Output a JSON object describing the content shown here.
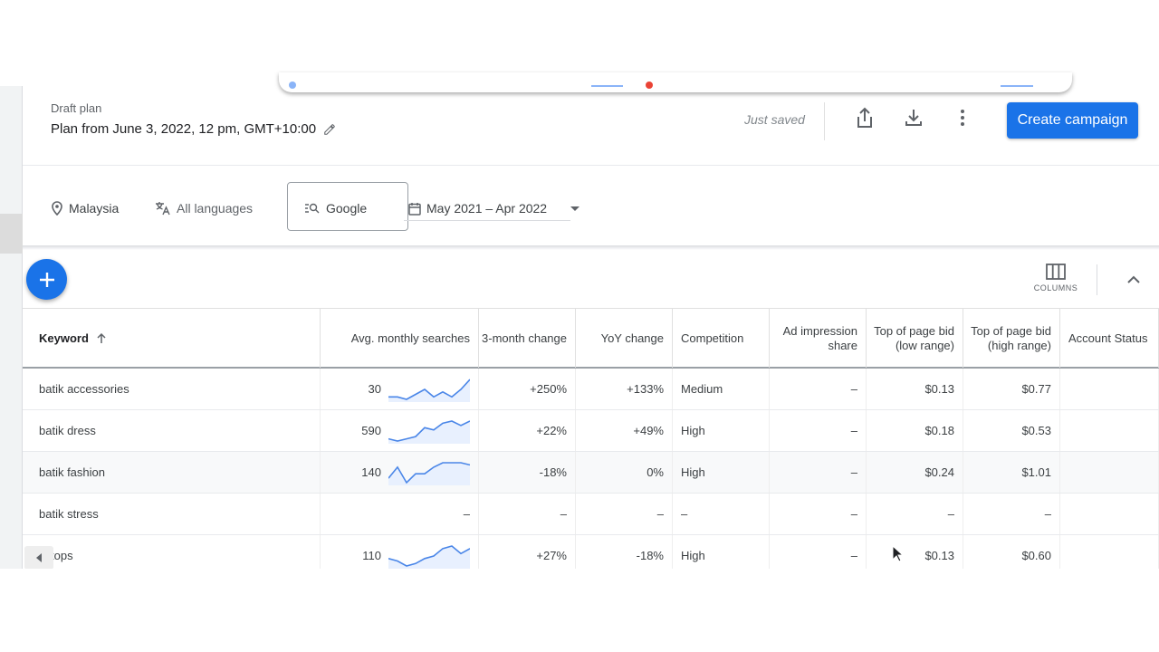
{
  "header": {
    "draft_label": "Draft plan",
    "plan_title": "Plan from June 3, 2022, 12 pm, GMT+10:00",
    "status": "Just saved",
    "create_button": "Create campaign",
    "icons": [
      "share-icon",
      "download-icon",
      "more-vert-icon",
      "pencil-icon"
    ]
  },
  "filters": {
    "location": "Malaysia",
    "language": "All languages",
    "network": "Google",
    "date_range": "May 2021 – Apr 2022"
  },
  "toolbar": {
    "columns_label": "COLUMNS"
  },
  "colors": {
    "accent": "#1a73e8",
    "sparkline": "#4a86e8",
    "sparkline_fill": "#e8f0fe"
  },
  "table": {
    "columns": [
      "Keyword",
      "Avg. monthly searches",
      "3-month change",
      "YoY change",
      "Competition",
      "Ad impression share",
      "Top of page bid (low range)",
      "Top of page bid (high range)",
      "Account Status"
    ],
    "rows": [
      {
        "keyword": "batik accessories",
        "searches": "30",
        "trend": [
          2,
          2,
          1,
          3,
          5,
          2,
          4,
          2,
          5,
          9
        ],
        "three_month": "+250%",
        "yoy": "+133%",
        "competition": "Medium",
        "impression_share": "–",
        "bid_low": "$0.13",
        "bid_high": "$0.77",
        "account_status": ""
      },
      {
        "keyword": "batik dress",
        "searches": "590",
        "trend": [
          2,
          1,
          2,
          3,
          7,
          6,
          9,
          10,
          8,
          10
        ],
        "three_month": "+22%",
        "yoy": "+49%",
        "competition": "High",
        "impression_share": "–",
        "bid_low": "$0.18",
        "bid_high": "$0.53",
        "account_status": ""
      },
      {
        "keyword": "batik fashion",
        "searches": "140",
        "trend": [
          3,
          8,
          1,
          5,
          5,
          8,
          10,
          10,
          10,
          9
        ],
        "three_month": "-18%",
        "yoy": "0%",
        "competition": "High",
        "impression_share": "–",
        "bid_low": "$0.24",
        "bid_high": "$1.01",
        "account_status": ""
      },
      {
        "keyword": "batik stress",
        "searches": "–",
        "trend": null,
        "three_month": "–",
        "yoy": "–",
        "competition": "–",
        "impression_share": "–",
        "bid_low": "–",
        "bid_high": "–",
        "account_status": ""
      },
      {
        "keyword": "ik tops",
        "searches": "110",
        "trend": [
          4,
          3,
          1,
          2,
          4,
          5,
          8,
          9,
          6,
          8
        ],
        "three_month": "+27%",
        "yoy": "-18%",
        "competition": "High",
        "impression_share": "–",
        "bid_low": "$0.13",
        "bid_high": "$0.60",
        "account_status": ""
      }
    ]
  }
}
